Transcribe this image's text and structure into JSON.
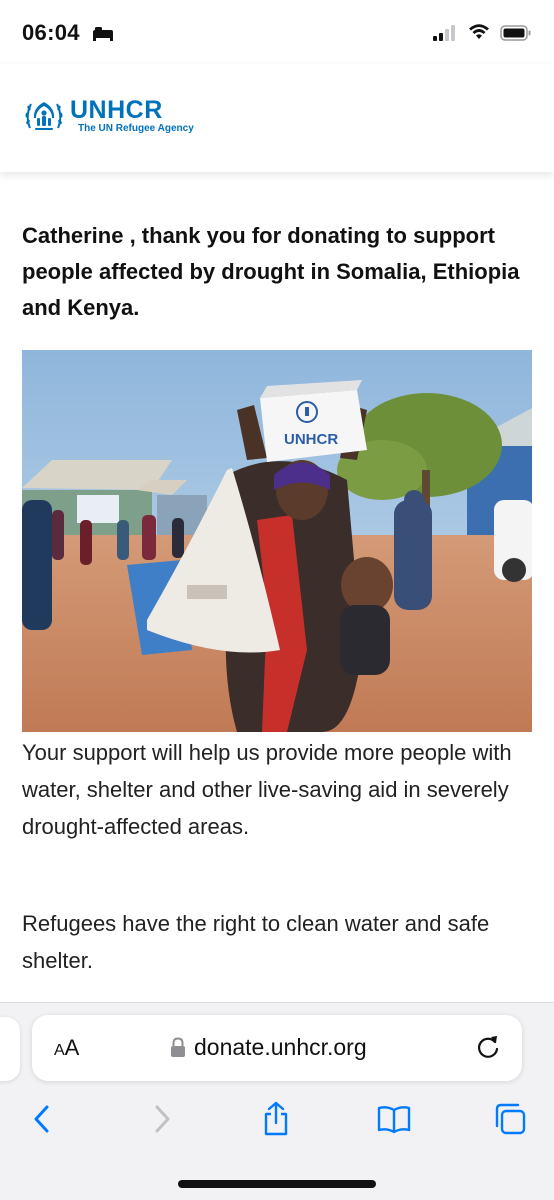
{
  "status_bar": {
    "time": "06:04",
    "icons": [
      "sleep-icon",
      "signal-icon",
      "wifi-icon",
      "battery-icon"
    ]
  },
  "header": {
    "logo_wordmark": "UNHCR",
    "logo_tagline": "The UN Refugee Agency",
    "brand_color": "#0072bc"
  },
  "main": {
    "headline": "Catherine , thank you for donating to support people affected by drought in Somalia, Ethiopia and Kenya.",
    "hero_box_label": "UNHCR",
    "paragraph_1": "Your support will help us provide more people with water, shelter and other live-saving aid in severely drought-affected areas.",
    "paragraph_2": "Refugees have the right to clean water and safe shelter."
  },
  "browser": {
    "text_size_label_large": "A",
    "text_size_label_small": "A",
    "url": "donate.unhcr.org",
    "icons": [
      "lock-icon",
      "reload-icon",
      "back-icon",
      "forward-icon",
      "share-icon",
      "bookmarks-icon",
      "tabs-icon"
    ],
    "accent_color": "#007aff"
  }
}
